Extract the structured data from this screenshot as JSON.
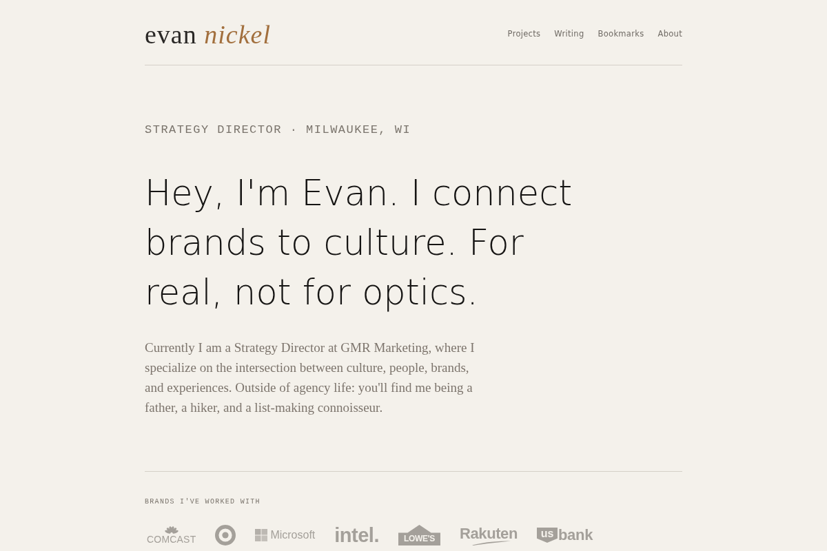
{
  "header": {
    "logo": "evan *nickel*",
    "nav": [
      "Projects",
      "Writing",
      "Bookmarks",
      "About"
    ]
  },
  "hero": {
    "eyebrow": "STRATEGY DIRECTOR · MILWAUKEE, WI",
    "headline": "Hey, I'm Evan. I connect brands to culture. For real, not for optics.",
    "intro": "Currently I am a Strategy Director at GMR Marketing, where I specialize on the intersection between culture, people, brands, and experiences. Outside of agency life: you'll find me being a father, a hiker, and a list-making connoisseur."
  },
  "brands": {
    "heading": "BRANDS I'VE WORKED WITH",
    "items": [
      {
        "kind": "peacock",
        "text": "COMCAST"
      },
      {
        "kind": "bullseye"
      },
      {
        "kind": "squares",
        "text": "Microsoft"
      },
      {
        "kind": "plain",
        "text": "intel."
      },
      {
        "kind": "house",
        "text": "LOWE'S"
      },
      {
        "kind": "swoosh",
        "text": "Rakuten"
      },
      {
        "kind": "shield",
        "badge": "us",
        "text": "bank"
      }
    ]
  }
}
